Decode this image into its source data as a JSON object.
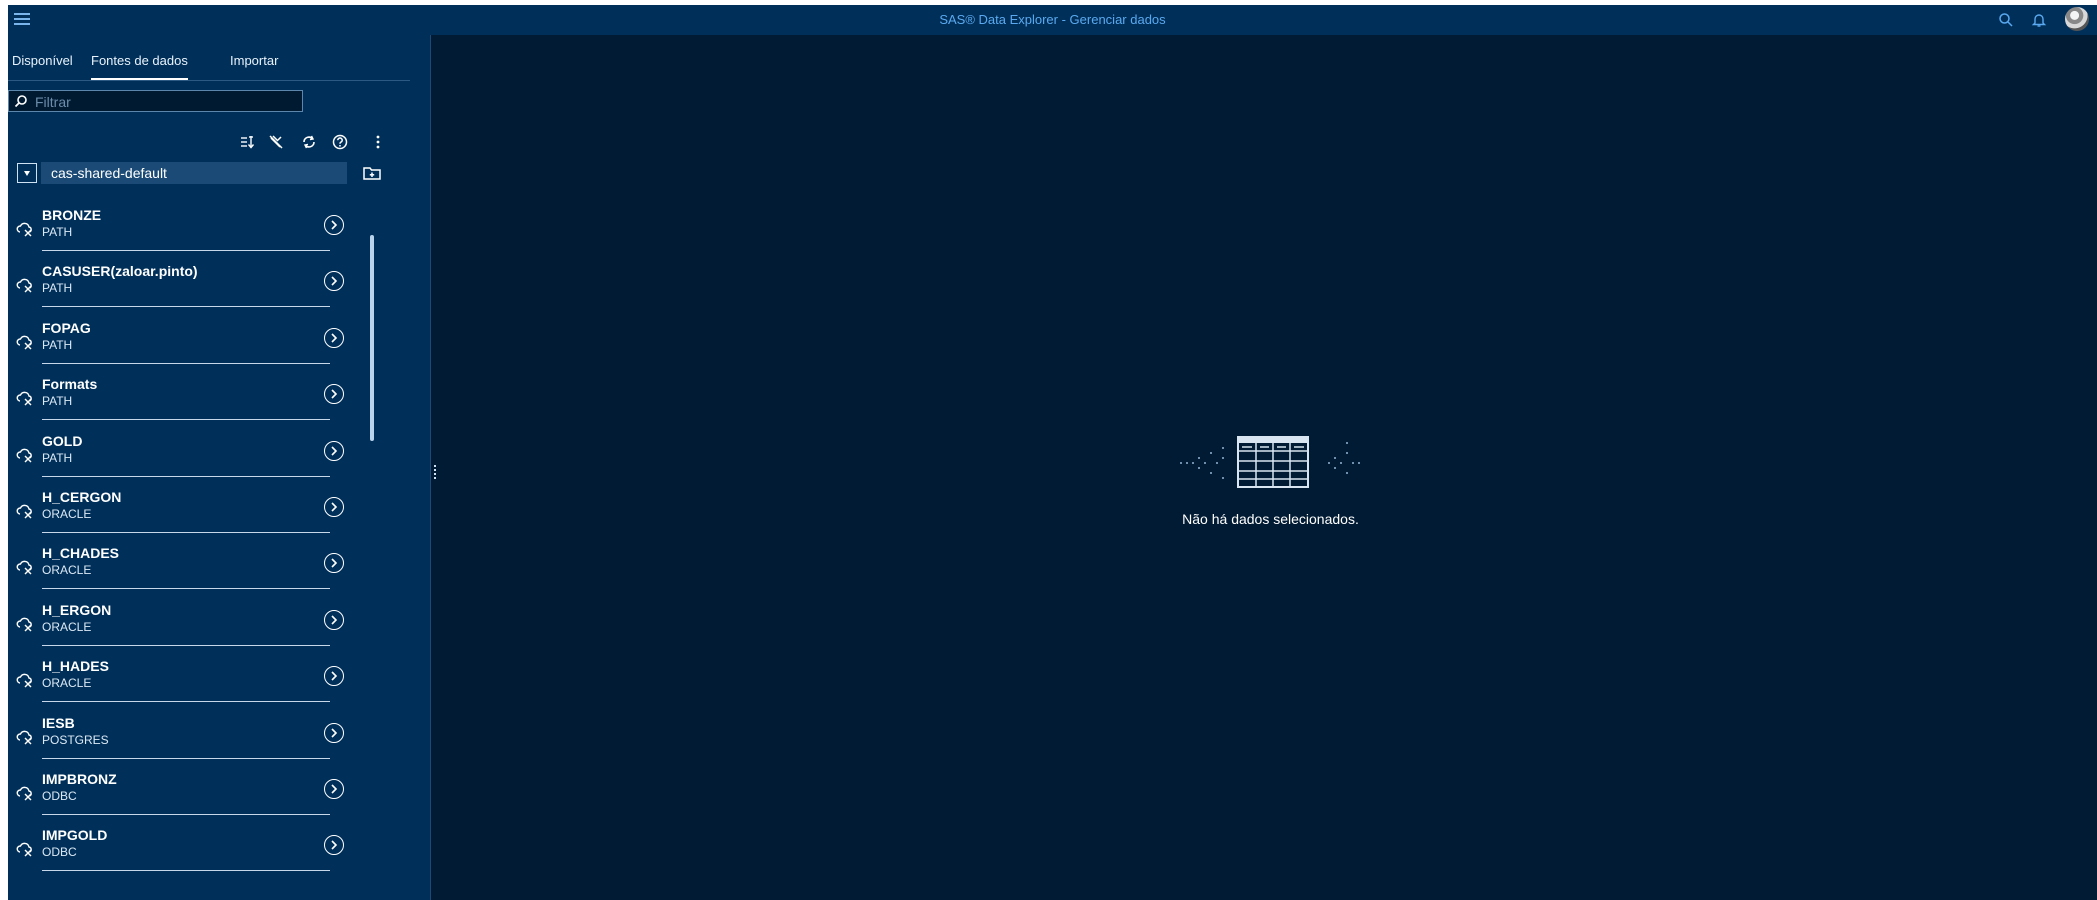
{
  "app": {
    "title": "SAS® Data Explorer - Gerenciar dados"
  },
  "topbar": {
    "menu_icon": "hamburger-menu-icon",
    "search_icon": "search-icon",
    "notifications_icon": "bell-icon",
    "avatar_icon": "user-avatar"
  },
  "tabs": [
    {
      "label": "Disponível",
      "active": false
    },
    {
      "label": "Fontes de dados",
      "active": true
    },
    {
      "label": "Importar",
      "active": false
    }
  ],
  "filter": {
    "placeholder": "Filtrar",
    "value": ""
  },
  "toolbar": {
    "icons": [
      "sort-filter-icon",
      "disconnect-icon",
      "refresh-icon",
      "help-icon",
      "more-options-icon"
    ]
  },
  "server": {
    "selected": "cas-shared-default",
    "folder_icon": "new-folder-icon"
  },
  "sources": [
    {
      "name": "BRONZE",
      "type": "PATH"
    },
    {
      "name": "CASUSER(zaloar.pinto)",
      "type": "PATH"
    },
    {
      "name": "FOPAG",
      "type": "PATH"
    },
    {
      "name": "Formats",
      "type": "PATH"
    },
    {
      "name": "GOLD",
      "type": "PATH"
    },
    {
      "name": "H_CERGON",
      "type": "ORACLE"
    },
    {
      "name": "H_CHADES",
      "type": "ORACLE"
    },
    {
      "name": "H_ERGON",
      "type": "ORACLE"
    },
    {
      "name": "H_HADES",
      "type": "ORACLE"
    },
    {
      "name": "IESB",
      "type": "POSTGRES"
    },
    {
      "name": "IMPBRONZ",
      "type": "ODBC"
    },
    {
      "name": "IMPGOLD",
      "type": "ODBC"
    }
  ],
  "empty_state": {
    "message": "Não há dados selecionados.",
    "icon": "table-grid-icon"
  },
  "colors": {
    "topbar": "#00305a",
    "panel": "#00305a",
    "canvas": "#001b33",
    "title_accent": "#5aa9f0",
    "text": "#ffffff"
  }
}
